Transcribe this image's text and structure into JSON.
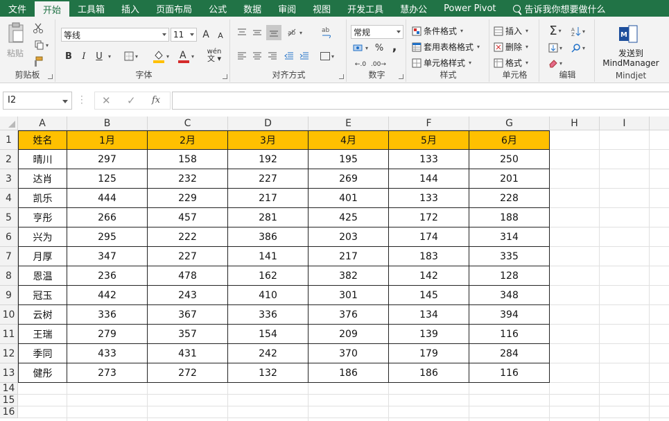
{
  "tabs": [
    "文件",
    "开始",
    "工具箱",
    "插入",
    "页面布局",
    "公式",
    "数据",
    "审阅",
    "视图",
    "开发工具",
    "慧办公",
    "Power Pivot"
  ],
  "active_tab": "开始",
  "tell_me": "告诉我你想要做什么",
  "ribbon": {
    "clipboard": {
      "paste": "粘贴",
      "label": "剪贴板"
    },
    "font": {
      "name": "等线",
      "size": "11",
      "bold": "B",
      "italic": "I",
      "underline": "U",
      "grow": "A",
      "shrink": "A",
      "phonetic": "wén",
      "label": "字体"
    },
    "alignment": {
      "label": "对齐方式"
    },
    "number": {
      "format": "常规",
      "percent": "%",
      "comma": ",",
      "label": "数字"
    },
    "styles": {
      "conditional": "条件格式",
      "table": "套用表格格式",
      "cell": "单元格样式",
      "label": "样式"
    },
    "cells": {
      "insert": "插入",
      "delete": "删除",
      "format": "格式",
      "label": "单元格"
    },
    "editing": {
      "label": "编辑"
    },
    "mindjet": {
      "send_line1": "发送到",
      "send_line2": "MindManager",
      "label": "Mindjet"
    }
  },
  "name_box": "I2",
  "fx": "fx",
  "columns": [
    "A",
    "B",
    "C",
    "D",
    "E",
    "F",
    "G",
    "H",
    "I"
  ],
  "rows": [
    "1",
    "2",
    "3",
    "4",
    "5",
    "6",
    "7",
    "8",
    "9",
    "10",
    "11",
    "12",
    "13",
    "14",
    "15",
    "16"
  ],
  "table": {
    "header": [
      "姓名",
      "1月",
      "2月",
      "3月",
      "4月",
      "5月",
      "6月"
    ],
    "rows": [
      [
        "晴川",
        "297",
        "158",
        "192",
        "195",
        "133",
        "250"
      ],
      [
        "达肖",
        "125",
        "232",
        "227",
        "269",
        "144",
        "201"
      ],
      [
        "凯乐",
        "444",
        "229",
        "217",
        "401",
        "133",
        "228"
      ],
      [
        "亨彤",
        "266",
        "457",
        "281",
        "425",
        "172",
        "188"
      ],
      [
        "兴为",
        "295",
        "222",
        "386",
        "203",
        "174",
        "314"
      ],
      [
        "月厚",
        "347",
        "227",
        "141",
        "217",
        "183",
        "335"
      ],
      [
        "恩温",
        "236",
        "478",
        "162",
        "382",
        "142",
        "128"
      ],
      [
        "冠玉",
        "442",
        "243",
        "410",
        "301",
        "145",
        "348"
      ],
      [
        "云树",
        "336",
        "367",
        "336",
        "376",
        "134",
        "394"
      ],
      [
        "王瑞",
        "279",
        "357",
        "154",
        "209",
        "139",
        "116"
      ],
      [
        "季同",
        "433",
        "431",
        "242",
        "370",
        "179",
        "284"
      ],
      [
        "健彤",
        "273",
        "272",
        "132",
        "186",
        "186",
        "116"
      ]
    ]
  },
  "colors": {
    "excel_green": "#217346",
    "header_fill": "#ffc000"
  }
}
